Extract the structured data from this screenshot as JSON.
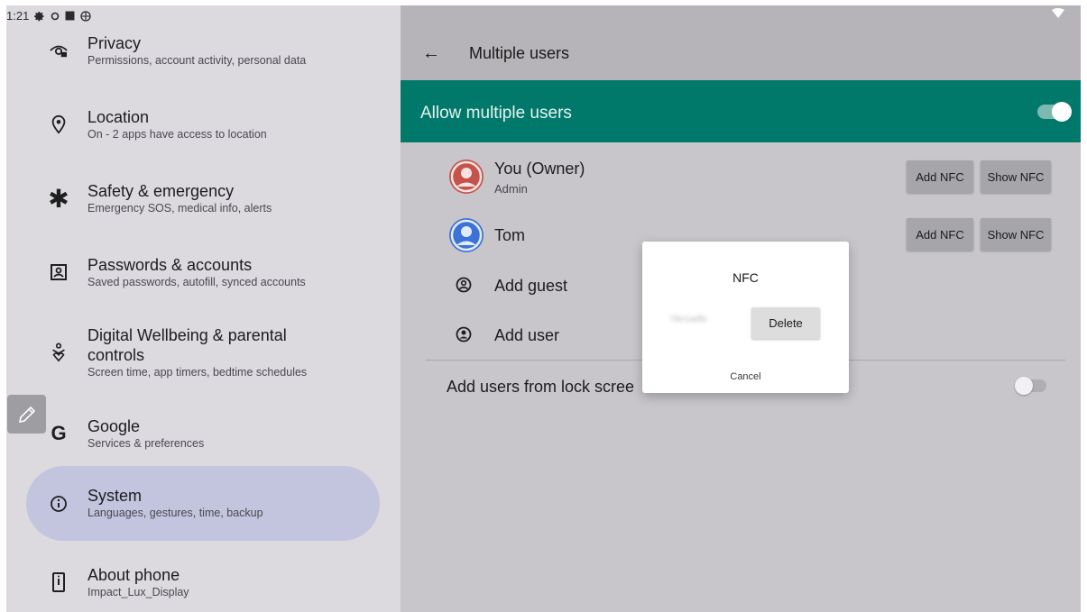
{
  "status_bar": {
    "time": "1:21"
  },
  "settings": {
    "items": [
      {
        "title": "Privacy",
        "subtitle": "Permissions, account activity, personal data",
        "icon": "privacy-icon"
      },
      {
        "title": "Location",
        "subtitle": "On - 2 apps have access to location",
        "icon": "location-icon"
      },
      {
        "title": "Safety & emergency",
        "subtitle": "Emergency SOS, medical info, alerts",
        "icon": "asterisk-icon"
      },
      {
        "title": "Passwords & accounts",
        "subtitle": "Saved passwords, autofill, synced accounts",
        "icon": "account-box-icon"
      },
      {
        "title_line1": "Digital Wellbeing & parental",
        "title_line2": "controls",
        "subtitle": "Screen time, app timers, bedtime schedules",
        "icon": "wellbeing-icon"
      },
      {
        "title": "Google",
        "subtitle": "Services & preferences",
        "icon": "google-g-icon",
        "icon_text": "G"
      },
      {
        "title": "System",
        "subtitle": "Languages, gestures, time, backup",
        "icon": "info-icon",
        "selected": true
      },
      {
        "title": "About phone",
        "subtitle": "Impact_Lux_Display",
        "icon": "phone-icon"
      }
    ]
  },
  "multiple_users": {
    "title": "Multiple users",
    "allow_label": "Allow multiple users",
    "allow_enabled": true,
    "users": [
      {
        "name": "You (Owner)",
        "role": "Admin",
        "avatar_color": "#c5534a",
        "add_nfc": "Add NFC",
        "show_nfc": "Show NFC"
      },
      {
        "name": "Tom",
        "role": "",
        "avatar_color": "#3d73d6",
        "add_nfc": "Add NFC",
        "show_nfc": "Show NFC"
      }
    ],
    "add_guest": "Add guest",
    "add_user": "Add user",
    "lock_screen_label": "Add users from lock scree",
    "lock_screen_enabled": false
  },
  "dialog": {
    "title": "NFC",
    "nfc_id": "78e1adfe",
    "delete_label": "Delete",
    "cancel_label": "Cancel"
  },
  "colors": {
    "accent_teal": "#00796b",
    "selected_item": "#c3c4de"
  }
}
